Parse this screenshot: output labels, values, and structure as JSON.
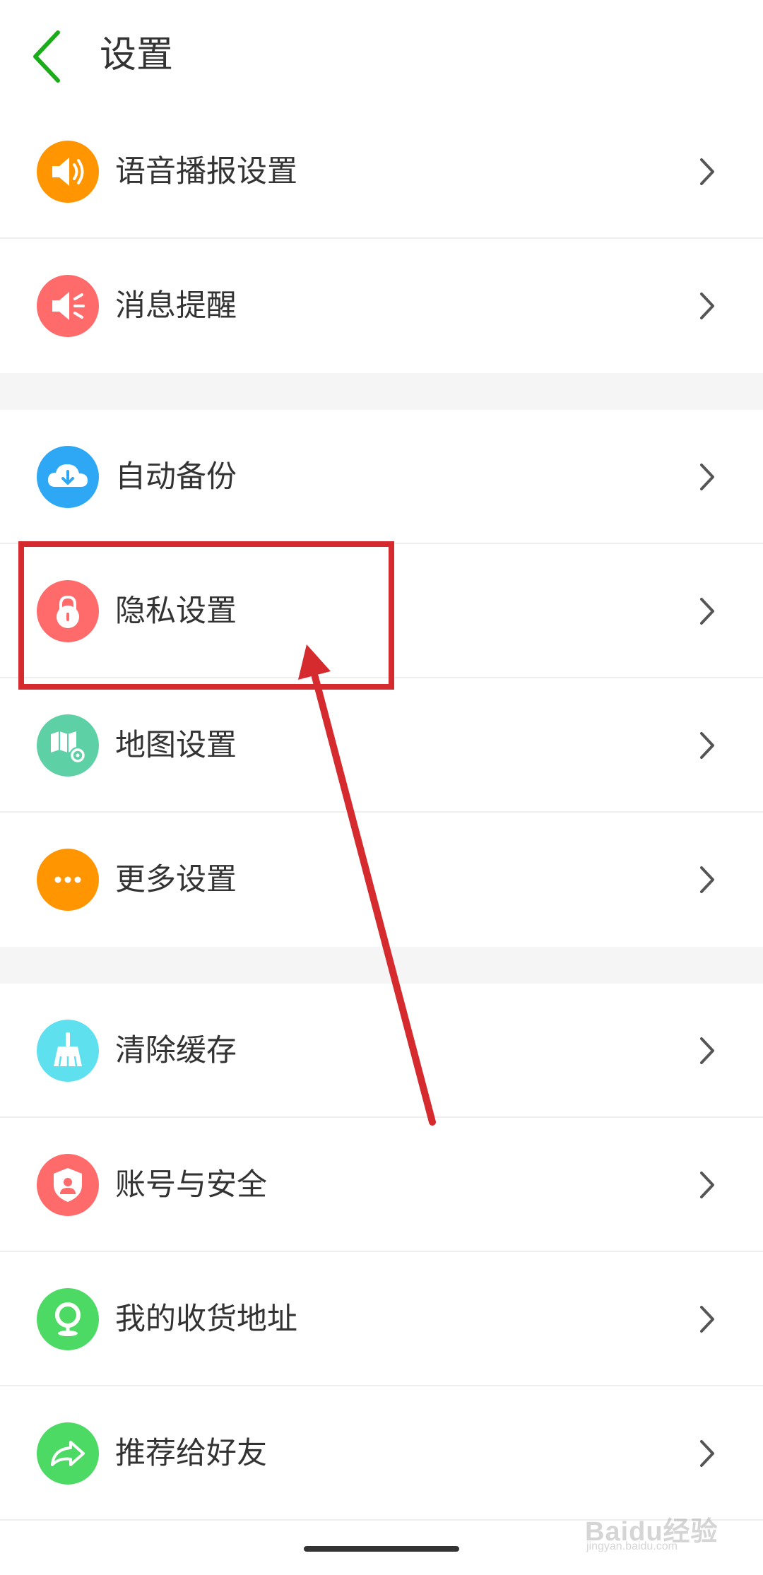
{
  "header": {
    "title": "设置",
    "back_icon": "chevron-left-icon",
    "accent": "#1aad19"
  },
  "items": [
    {
      "label": "语音播报设置",
      "icon": "speaker-icon",
      "color": "#ff9500"
    },
    {
      "label": "消息提醒",
      "icon": "megaphone-icon",
      "color": "#ff6b6b"
    },
    {
      "label": "自动备份",
      "icon": "cloud-download-icon",
      "color": "#2ea7f5"
    },
    {
      "label": "隐私设置",
      "icon": "lock-icon",
      "color": "#ff6b6b"
    },
    {
      "label": "地图设置",
      "icon": "map-settings-icon",
      "color": "#5ed0a6"
    },
    {
      "label": "更多设置",
      "icon": "more-dots-icon",
      "color": "#ff9500"
    },
    {
      "label": "清除缓存",
      "icon": "broom-icon",
      "color": "#5ee0ef"
    },
    {
      "label": "账号与安全",
      "icon": "shield-user-icon",
      "color": "#ff6b6b"
    },
    {
      "label": "我的收货地址",
      "icon": "location-pin-icon",
      "color": "#4cd964"
    },
    {
      "label": "推荐给好友",
      "icon": "share-arrow-icon",
      "color": "#4cd964"
    }
  ],
  "annotation": {
    "color": "#d62b2e"
  },
  "watermark": {
    "text": "Baidu经验",
    "sub": "jingyan.baidu.com"
  }
}
